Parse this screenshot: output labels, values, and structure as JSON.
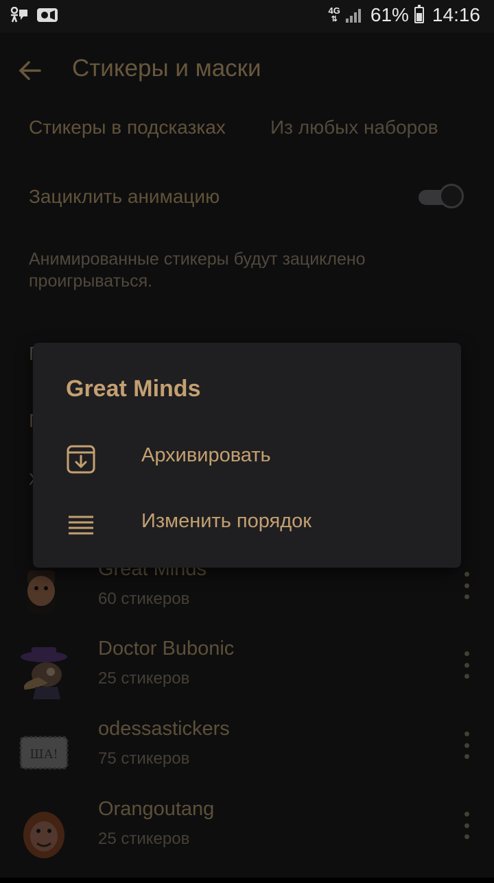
{
  "status_bar": {
    "network": "4G",
    "battery": "61%",
    "time": "14:16"
  },
  "app_bar": {
    "title": "Стикеры и маски"
  },
  "settings": {
    "suggest": {
      "label": "Стикеры в подсказках",
      "value": "Из любых наборов"
    },
    "loop": {
      "label": "Зациклить анимацию",
      "enabled": true
    },
    "loop_hint": "Анимированные стикеры будут зациклено проигрываться."
  },
  "packs": [
    {
      "name": "Great Minds",
      "count": "60 стикеров",
      "icon": "lincoln-sticker-icon"
    },
    {
      "name": "Doctor Bubonic",
      "count": "25 стикеров",
      "icon": "plague-doctor-sticker-icon"
    },
    {
      "name": "odessastickers",
      "count": "75 стикеров",
      "icon": "sha-sticker-icon",
      "thumb_text": "ША!"
    },
    {
      "name": "Orangoutang",
      "count": "25 стикеров",
      "icon": "orangutan-sticker-icon"
    }
  ],
  "popup": {
    "title": "Great Minds",
    "items": [
      {
        "label": "Архивировать",
        "icon": "archive-icon"
      },
      {
        "label": "Изменить порядок",
        "icon": "reorder-icon"
      }
    ]
  },
  "colors": {
    "accent": "#c4a071",
    "background": "#131314",
    "popup": "#1f1f21"
  }
}
